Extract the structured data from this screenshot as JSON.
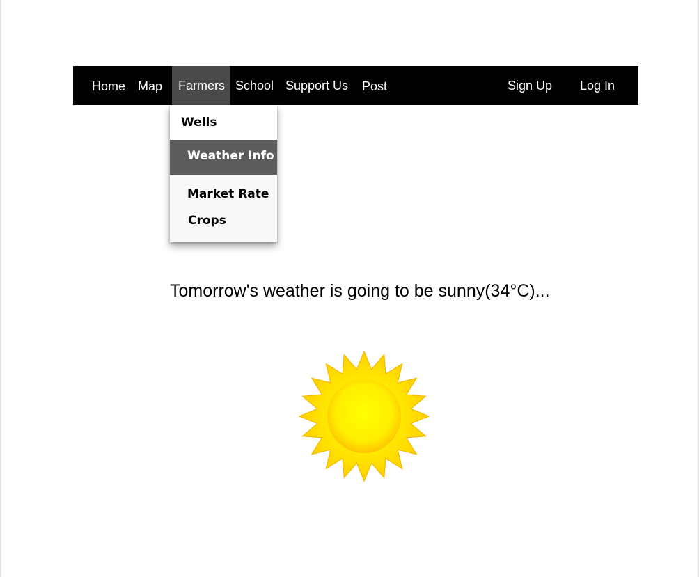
{
  "nav": {
    "items": [
      {
        "label": "Home"
      },
      {
        "label": "Map"
      },
      {
        "label": "Farmers"
      },
      {
        "label": "School"
      },
      {
        "label": "Support Us"
      },
      {
        "label": "Post"
      }
    ],
    "active": "Farmers",
    "sign_up": "Sign Up",
    "log_in": "Log In"
  },
  "dropdown": {
    "items": [
      {
        "label": "Wells"
      },
      {
        "label": "Weather Info"
      },
      {
        "label": "Market Rate"
      },
      {
        "label": "Crops"
      }
    ],
    "highlighted": "Weather Info"
  },
  "main": {
    "forecast_text": "Tomorrow's weather is going to be sunny(34°C)...",
    "weather_icon": "sun-icon"
  },
  "colors": {
    "navbar_bg": "#000000",
    "active_tab_bg": "#4a4a4a",
    "highlight_bg": "#5c5c5c",
    "sun_core": "#ffee00",
    "sun_rays": "#ffd200"
  }
}
